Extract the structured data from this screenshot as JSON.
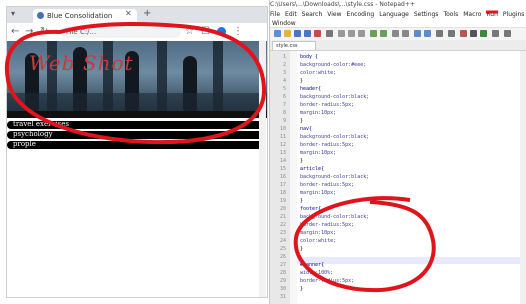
{
  "browser": {
    "tab_title": "Blue Consolidation",
    "tab_close_icon": "close-icon",
    "new_tab_icon": "plus-icon",
    "back_icon": "arrow-left-icon",
    "forward_icon": "arrow-right-icon",
    "reload_icon": "reload-icon",
    "address": "File  C:/...",
    "bookmark_icon": "star-icon",
    "banner_text": "Web Shot",
    "menu_items": [
      "travel exercises",
      "psychology",
      "prople"
    ]
  },
  "editor": {
    "title": "C:\\Users\\...\\Downloads\\...\\style.css - Notepad++",
    "menu": [
      "File",
      "Edit",
      "Search",
      "View",
      "Encoding",
      "Language",
      "Settings",
      "Tools",
      "Macro",
      "Run",
      "Plugins"
    ],
    "windows_label": "Window",
    "file_tab": "style.css",
    "line_numbers": [
      "1",
      "2",
      "3",
      "4",
      "5",
      "6",
      "7",
      "8",
      "9",
      "10",
      "11",
      "12",
      "13",
      "14",
      "15",
      "16",
      "17",
      "18",
      "19",
      "20",
      "21",
      "22",
      "23",
      "24",
      "25",
      "26",
      "27",
      "28",
      "29",
      "30",
      "31"
    ],
    "code_lines": [
      {
        "text": "body {",
        "kind": "sel"
      },
      {
        "text": "    background-color:#eee;",
        "kind": "prop"
      },
      {
        "text": "    color:white;",
        "kind": "prop"
      },
      {
        "text": "}",
        "kind": "brace"
      },
      {
        "text": "header{",
        "kind": "sel"
      },
      {
        "text": "    background-color:black;",
        "kind": "prop"
      },
      {
        "text": "    border-radius:5px;",
        "kind": "prop"
      },
      {
        "text": "    margin:10px;",
        "kind": "prop"
      },
      {
        "text": "}",
        "kind": "brace"
      },
      {
        "text": "nav{",
        "kind": "sel"
      },
      {
        "text": "    background-color:black;",
        "kind": "prop"
      },
      {
        "text": "    border-radius:5px;",
        "kind": "prop"
      },
      {
        "text": "    margin:10px;",
        "kind": "prop"
      },
      {
        "text": "}",
        "kind": "brace"
      },
      {
        "text": "article{",
        "kind": "sel"
      },
      {
        "text": "    background-color:black;",
        "kind": "prop"
      },
      {
        "text": "    border-radius:5px;",
        "kind": "prop"
      },
      {
        "text": "    margin:10px;",
        "kind": "prop"
      },
      {
        "text": "}",
        "kind": "brace"
      },
      {
        "text": "footer{",
        "kind": "sel"
      },
      {
        "text": "    background-color:black;",
        "kind": "prop"
      },
      {
        "text": "    border-radius:5px;",
        "kind": "prop"
      },
      {
        "text": "    margin:10px;",
        "kind": "prop"
      },
      {
        "text": "    color:white;",
        "kind": "prop"
      },
      {
        "text": "}",
        "kind": "brace"
      },
      {
        "text": "",
        "kind": "prop"
      },
      {
        "text": "#banner{",
        "kind": "sel"
      },
      {
        "text": "    width:100%;",
        "kind": "prop"
      },
      {
        "text": "    border-radius:5px;",
        "kind": "prop"
      },
      {
        "text": "}",
        "kind": "brace"
      },
      {
        "text": "",
        "kind": "prop"
      }
    ]
  },
  "colors": {
    "annotation_red": "#e0141c",
    "selector_blue": "#0000a0",
    "banner_text_red": "#c43b3b"
  }
}
